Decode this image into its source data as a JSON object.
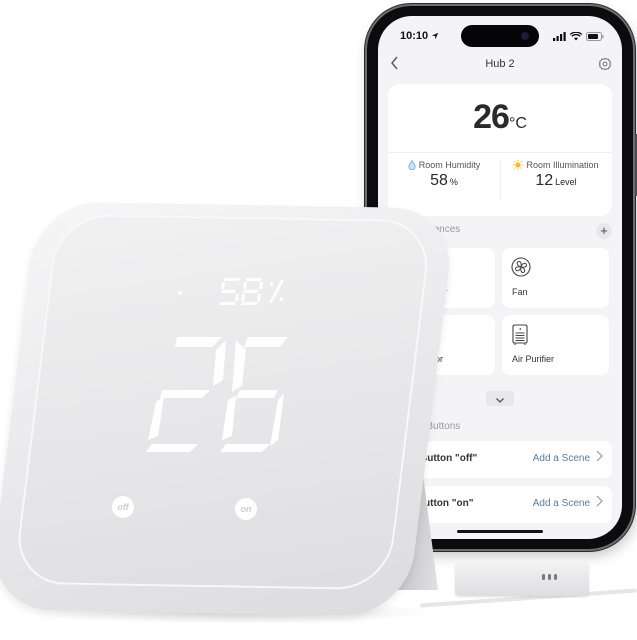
{
  "app": {
    "status_bar": {
      "time": "10:10"
    },
    "nav": {
      "title": "Hub 2",
      "back_label": "<"
    },
    "climate": {
      "temperature": "26",
      "temperature_unit": "°C",
      "humidity_label": "Room Humidity",
      "humidity_value": "58",
      "humidity_unit": "%",
      "illumination_label": "Room Illumination",
      "illumination_value": "12",
      "illumination_unit": "Level"
    },
    "appliances": {
      "section_label": "Appliances",
      "visible_section_label": "ppliances",
      "add_label": "+",
      "tiles": [
        {
          "label": "Player",
          "visible_label": "layer",
          "icon": "media-player-icon"
        },
        {
          "label": "Fan",
          "visible_label": "Fan",
          "icon": "fan-icon"
        },
        {
          "label": "Projector",
          "visible_label": "ctor",
          "icon": "projector-icon"
        },
        {
          "label": "Air Purifier",
          "visible_label": "Air Purifier",
          "icon": "air-purifier-icon"
        }
      ],
      "expand_icon": "chevron-down-icon"
    },
    "buttons_section": {
      "section_label": "Touch Buttons",
      "visible_section_label": "h Buttons",
      "rows": [
        {
          "name": "Button \"off\"",
          "action": "Add a Scene"
        },
        {
          "name": "Button \"on\"",
          "visible_name": "utton \"on\"",
          "action": "Add a Scene"
        }
      ]
    }
  },
  "device": {
    "humidity_display": "58",
    "humidity_unit": "%",
    "temperature_display": "26",
    "off_button_label": "off",
    "on_button_label": "on"
  },
  "colors": {
    "link_blue": "#5a7c9a",
    "humidity_drop": "#7ab0d8",
    "sun_yellow": "#f5b82e",
    "phone_frame": "#0c0c0e",
    "device_white": "#ececee"
  }
}
